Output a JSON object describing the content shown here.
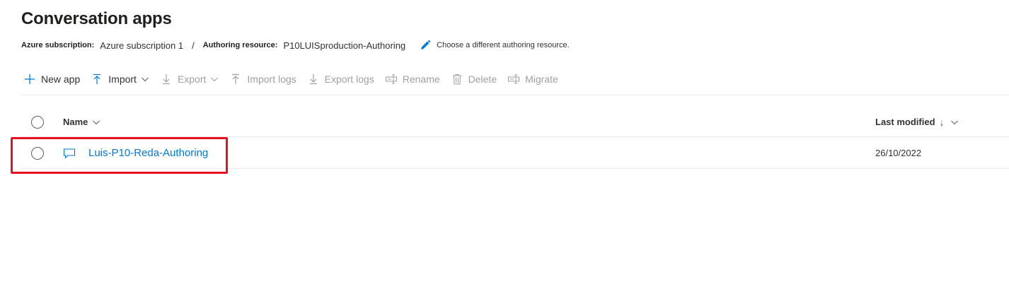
{
  "page": {
    "title": "Conversation apps"
  },
  "meta": {
    "subscription_key": "Azure subscription:",
    "subscription_value": "Azure subscription 1",
    "separator": "/",
    "resource_key": "Authoring resource:",
    "resource_value": "P10LUISproduction-Authoring",
    "change_link": "Choose a different authoring resource."
  },
  "toolbar": {
    "new_app": "New app",
    "import": "Import",
    "export": "Export",
    "import_logs": "Import logs",
    "export_logs": "Export logs",
    "rename": "Rename",
    "delete": "Delete",
    "migrate": "Migrate"
  },
  "table": {
    "columns": {
      "name": "Name",
      "last_modified": "Last modified",
      "sort_arrow": "↓"
    },
    "rows": [
      {
        "name": "Luis-P10-Reda-Authoring",
        "last_modified": "26/10/2022"
      }
    ]
  },
  "colors": {
    "accent": "#0078d4",
    "highlight": "#e81123",
    "disabled": "#a19f9d"
  }
}
